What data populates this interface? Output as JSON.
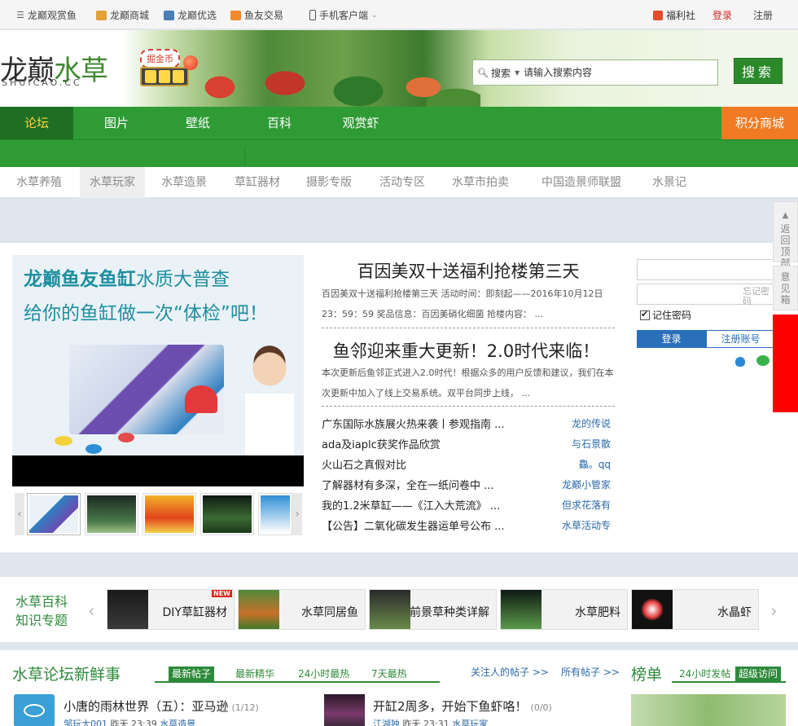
{
  "topbar": {
    "items": [
      "龙巅观赏鱼",
      "龙巅商城",
      "龙巅优选",
      "鱼友交易",
      "手机客户端"
    ],
    "welfare": "福利社",
    "login": "登录",
    "register": "注册"
  },
  "banner": {
    "logo_left": "龙巅",
    "logo_right": "水草",
    "logo_sub": "SHUICAO.CC",
    "coin_badge": "掘金币",
    "search_scope": "搜索",
    "search_placeholder": "请输入搜索内容",
    "search_button": "搜索"
  },
  "mainnav": {
    "items": [
      "论坛",
      "图片",
      "壁纸",
      "百科",
      "观赏虾"
    ],
    "points": "积分商城"
  },
  "subnav": {
    "items": [
      "水草养殖",
      "水草玩家",
      "水草造景",
      "草缸器材",
      "摄影专版",
      "活动专区",
      "水草市拍卖",
      "中国造景师联盟",
      "水景记"
    ],
    "active_index": 1
  },
  "slide": {
    "line1_bold": "龙巅鱼友鱼缸",
    "line1_light": "水质大普查",
    "line2": "给你的鱼缸做一次“体检”吧！"
  },
  "headlines": [
    {
      "title": "百因美双十送福利抢楼第三天",
      "desc": "百因美双十送福利抢楼第三天 活动时间：即刻起——2016年10月12日23：59：59 奖品信息：百因美硝化细菌 抢楼内容： ..."
    },
    {
      "title": "鱼邻迎来重大更新！2.0时代来临！",
      "desc": "本次更新后鱼邻正式进入2.0时代！根据众多的用户反馈和建议，我们在本次更新中加入了线上交易系统。双平台同步上线， ..."
    }
  ],
  "news": [
    {
      "title": "广东国际水族展火热来袭丨参观指南 ...",
      "author": "龙的传说"
    },
    {
      "title": "ada及iaplc获奖作品欣赏",
      "author": "与石景散"
    },
    {
      "title": "火山石之真假对比",
      "author": "鱻。qq"
    },
    {
      "title": "了解器材有多深，全在一纸问卷中 ...",
      "author": "龙巅小管家"
    },
    {
      "title": "我的1.2米草缸——《江入大荒流》 ...",
      "author": "但求花落有"
    },
    {
      "title": "【公告】二氧化碳发生器运单号公布 ...",
      "author": "水草活动专"
    }
  ],
  "login": {
    "forgot": "忘记密码",
    "remember": "记住密码",
    "login_btn": "登录",
    "register_btn": "注册账号"
  },
  "side": {
    "back_top": "返回顶部",
    "feedback": "意见箱"
  },
  "knowledge": {
    "title": "水草百科知识专题",
    "new_badge": "NEW",
    "cards": [
      "DIY草缸器材",
      "水草同居鱼",
      "前景草种类详解",
      "水草肥料",
      "水晶虾"
    ]
  },
  "forum": {
    "title": "水草论坛新鲜事",
    "tabs": [
      "最新帖子",
      "最新精华",
      "24小时最热",
      "7天最热"
    ],
    "links": [
      "关注人的帖子 >>",
      "所有帖子 >>"
    ],
    "rank_title": "榜单",
    "rank_tabs": [
      "24小时发帖",
      "超级访问"
    ],
    "posts": [
      {
        "title": "小唐的雨林世界（五）：亚马逊",
        "count": "(1/12)",
        "user": "邹玩大001",
        "time": "昨天 23:39",
        "board": "水草造景"
      },
      {
        "title": "开缸2周多，开始下鱼虾咯！",
        "count": "(0/0)",
        "user": "江湖独",
        "time": "昨天 23:31",
        "board": "水草玩家"
      }
    ]
  },
  "colors": {
    "nav_green": "#2f9b35",
    "forum_active": "#1e6f23",
    "forum_label": "#ffd23c",
    "points_orange": "#f07b24",
    "link_blue": "#2a69a8",
    "login_blue": "#2a6fba"
  }
}
